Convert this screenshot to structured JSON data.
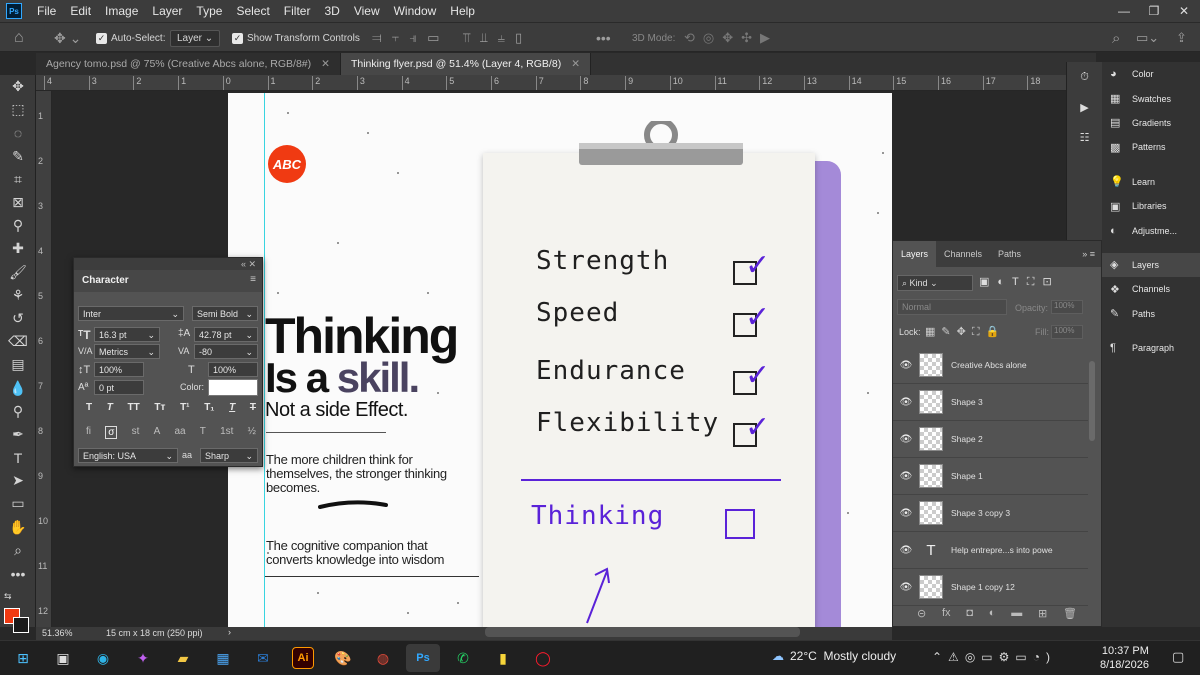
{
  "menu": [
    "File",
    "Edit",
    "Image",
    "Layer",
    "Type",
    "Select",
    "Filter",
    "3D",
    "View",
    "Window",
    "Help"
  ],
  "app_logo": "Ps",
  "options": {
    "auto_select": "Auto-Select:",
    "layer_dropdown": "Layer",
    "transform": "Show Transform Controls",
    "mode_3d": "3D Mode:"
  },
  "tabs": [
    {
      "label": "Agency tomo.psd @ 75% (Creative Abcs alone, RGB/8#)",
      "active": false
    },
    {
      "label": "Thinking flyer.psd @ 51.4% (Layer 4, RGB/8)",
      "active": true
    }
  ],
  "ruler_top": [
    "4",
    "3",
    "2",
    "1",
    "0",
    "1",
    "2",
    "3",
    "4",
    "5",
    "6",
    "7",
    "8",
    "9",
    "10",
    "11",
    "12",
    "13",
    "14",
    "15",
    "16",
    "17",
    "18"
  ],
  "ruler_left": [
    "1",
    "2",
    "3",
    "4",
    "5",
    "6",
    "7",
    "8",
    "9",
    "10",
    "11",
    "12"
  ],
  "flyer": {
    "logo": "ABC",
    "headline1": "Thinking",
    "headline2a": "Is a ",
    "headline2b": "skill.",
    "subhead": "Not a side Effect.",
    "para1": "The more children think for themselves, the stronger thinking becomes.",
    "para2": "The cognitive companion that converts knowledge into wisdom",
    "checklist": [
      "Strength",
      "Speed",
      "Endurance",
      "Flexibility"
    ],
    "goal": "Thinking"
  },
  "character": {
    "title": "Character",
    "font": "Inter",
    "style": "Semi Bold",
    "size": "16.3 pt",
    "leading": "42.78 pt",
    "kerning": "Metrics",
    "tracking": "-80",
    "vscale": "100%",
    "hscale": "100%",
    "baseline": "0 pt",
    "color_label": "Color:",
    "language": "English: USA",
    "aa_label": "aа",
    "antialias": "Sharp",
    "type_buttons": [
      "T",
      "T",
      "TT",
      "Tт",
      "T¹",
      "T₁",
      "T",
      "T"
    ],
    "ot_buttons": [
      "fi",
      "σ",
      "st",
      "A",
      "aa",
      "T",
      "1st",
      "½"
    ]
  },
  "status": {
    "zoom": "51.36%",
    "doc_size": "15 cm x 18 cm (250 ppi)"
  },
  "panels": [
    {
      "icon": "color-icon",
      "label": "Color"
    },
    {
      "icon": "swatches-icon",
      "label": "Swatches"
    },
    {
      "icon": "gradients-icon",
      "label": "Gradients"
    },
    {
      "icon": "patterns-icon",
      "label": "Patterns"
    },
    {
      "icon": "learn-icon",
      "label": "Learn"
    },
    {
      "icon": "libraries-icon",
      "label": "Libraries"
    },
    {
      "icon": "adjustments-icon",
      "label": "Adjustme..."
    },
    {
      "icon": "layers-icon",
      "label": "Layers"
    },
    {
      "icon": "channels-icon",
      "label": "Channels"
    },
    {
      "icon": "paths-icon",
      "label": "Paths"
    },
    {
      "icon": "paragraph-icon",
      "label": "Paragraph"
    }
  ],
  "layers_panel": {
    "tabs": [
      "Layers",
      "Channels",
      "Paths"
    ],
    "filter": "Kind",
    "blend": "Normal",
    "opacity_label": "Opacity:",
    "opacity": "100%",
    "lock_label": "Lock:",
    "fill_label": "Fill:",
    "fill": "100%",
    "layers": [
      {
        "name": "Creative Abcs alone",
        "type": "image"
      },
      {
        "name": "Shape 3",
        "type": "image"
      },
      {
        "name": "Shape 2",
        "type": "image"
      },
      {
        "name": "Shape 1",
        "type": "image"
      },
      {
        "name": "Shape 3 copy 3",
        "type": "image"
      },
      {
        "name": "Help entrepre...s into powe",
        "type": "text"
      },
      {
        "name": "Shape 1 copy 12",
        "type": "image"
      }
    ]
  },
  "taskbar": {
    "weather_temp": "22°C",
    "weather_desc": "Mostly cloudy",
    "time": "10:37 PM",
    "date": "8/18/2026"
  },
  "colors": {
    "accent": "#5a22d8",
    "brand_orange": "#f03a12",
    "clipboard_purple": "#a48ad8",
    "guide": "#38d4e0"
  }
}
